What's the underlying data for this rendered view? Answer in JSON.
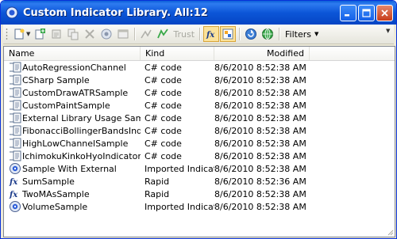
{
  "window": {
    "title": "Custom Indicator Library. All:12"
  },
  "toolbar": {
    "trust_label": "Trust",
    "filters_label": "Filters"
  },
  "columns": {
    "name": "Name",
    "kind": "Kind",
    "modified": "Modified"
  },
  "rows": [
    {
      "name": "AutoRegressionChannel",
      "kind": "C# code",
      "modified": "8/6/2010 8:52:38 AM",
      "icon": "csharp-code-icon"
    },
    {
      "name": "CSharp Sample",
      "kind": "C# code",
      "modified": "8/6/2010 8:52:38 AM",
      "icon": "csharp-code-icon"
    },
    {
      "name": "CustomDrawATRSample",
      "kind": "C# code",
      "modified": "8/6/2010 8:52:38 AM",
      "icon": "csharp-code-icon"
    },
    {
      "name": "CustomPaintSample",
      "kind": "C# code",
      "modified": "8/6/2010 8:52:38 AM",
      "icon": "csharp-code-icon"
    },
    {
      "name": "External Library Usage Sample",
      "kind": "C# code",
      "modified": "8/6/2010 8:52:38 AM",
      "icon": "csharp-code-icon"
    },
    {
      "name": "FibonacciBollingerBandsIndi...",
      "kind": "C# code",
      "modified": "8/6/2010 8:52:38 AM",
      "icon": "csharp-code-icon"
    },
    {
      "name": "HighLowChannelSample",
      "kind": "C# code",
      "modified": "8/6/2010 8:52:38 AM",
      "icon": "csharp-code-icon"
    },
    {
      "name": "IchimokuKinkoHyoIndicator",
      "kind": "C# code",
      "modified": "8/6/2010 8:52:38 AM",
      "icon": "csharp-code-icon"
    },
    {
      "name": "Sample With External",
      "kind": "Imported Indicator",
      "modified": "8/6/2010 8:52:38 AM",
      "icon": "imported-indicator-icon"
    },
    {
      "name": "SumSample",
      "kind": "Rapid",
      "modified": "8/6/2010 8:52:36 AM",
      "icon": "rapid-fx-icon"
    },
    {
      "name": "TwoMAsSample",
      "kind": "Rapid",
      "modified": "8/6/2010 8:52:38 AM",
      "icon": "rapid-fx-icon"
    },
    {
      "name": "VolumeSample",
      "kind": "Imported Indicator",
      "modified": "8/6/2010 8:52:38 AM",
      "icon": "imported-indicator-icon"
    }
  ]
}
